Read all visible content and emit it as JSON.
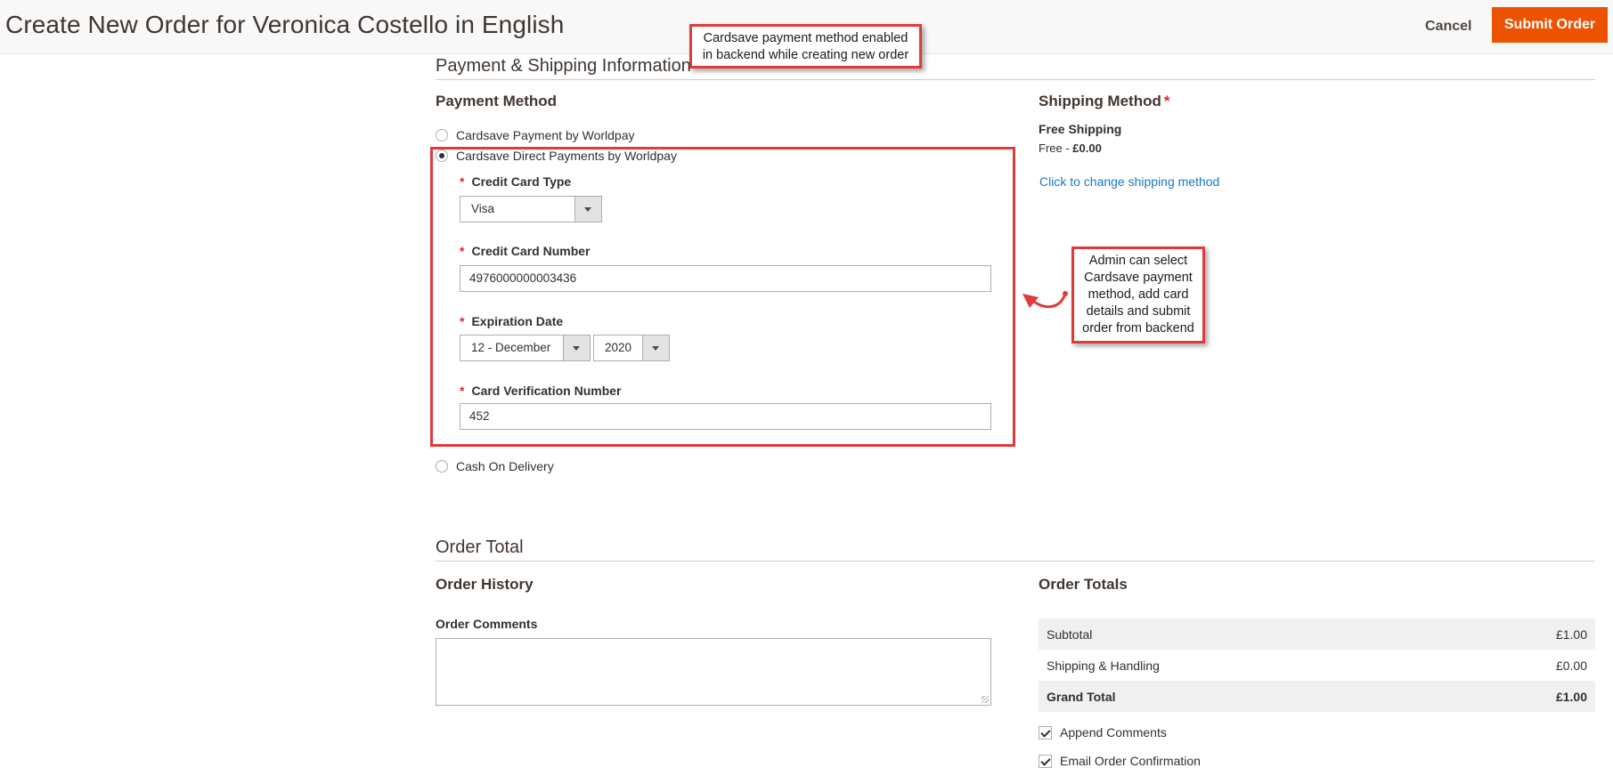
{
  "header": {
    "title": "Create New Order for Veronica Costello in English",
    "cancel_label": "Cancel",
    "submit_label": "Submit Order"
  },
  "callouts": {
    "top": "Cardsave payment method enabled in backend while creating new order",
    "side": "Admin can select Cardsave payment method, add card details and submit order from backend"
  },
  "payment_shipping": {
    "section_title": "Payment & Shipping Information",
    "payment_method_title": "Payment Method",
    "options": [
      {
        "label": "Cardsave Payment by Worldpay",
        "checked": false
      },
      {
        "label": "Cardsave Direct Payments by Worldpay",
        "checked": true
      },
      {
        "label": "Cash On Delivery",
        "checked": false
      }
    ],
    "required_mark": "*",
    "card_type": {
      "label": "Credit Card Type",
      "value": "Visa"
    },
    "card_number": {
      "label": "Credit Card Number",
      "value": "4976000000003436"
    },
    "expiration": {
      "label": "Expiration Date",
      "month": "12 - December",
      "year": "2020"
    },
    "cvv": {
      "label": "Card Verification Number",
      "value": "452"
    },
    "shipping": {
      "title": "Shipping Method",
      "required_mark": "*",
      "method_name": "Free Shipping",
      "price_prefix": "Free - ",
      "price": "£0.00",
      "change_link": "Click to change shipping method"
    }
  },
  "order_total": {
    "section_title": "Order Total",
    "history_title": "Order History",
    "comments_label": "Order Comments",
    "comments_value": "",
    "totals_title": "Order Totals",
    "rows": [
      {
        "label": "Subtotal",
        "value": "£1.00"
      },
      {
        "label": "Shipping & Handling",
        "value": "£0.00"
      },
      {
        "label": "Grand Total",
        "value": "£1.00"
      }
    ],
    "append_comments": {
      "label": "Append Comments",
      "checked": true
    },
    "email_confirmation": {
      "label": "Email Order Confirmation",
      "checked": true
    }
  },
  "colors": {
    "accent": "#eb5202",
    "annotation": "#e03a3a",
    "link": "#1979c3",
    "required": "#e22626"
  }
}
